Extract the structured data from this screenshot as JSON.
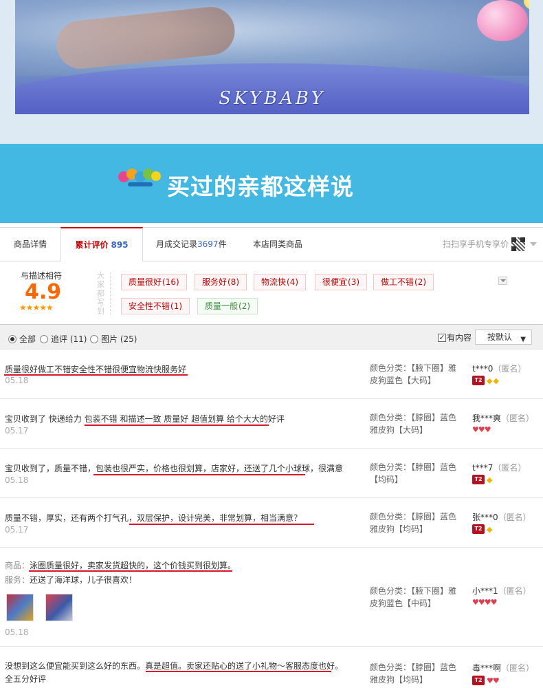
{
  "hero": {
    "brand": "SKYBABY"
  },
  "banner": {
    "title": "买过的亲都这样说",
    "logo_icon": "brand-logo-icon"
  },
  "tabs": {
    "items": [
      {
        "label": "商品详情"
      },
      {
        "label": "累计评价",
        "count": "895"
      },
      {
        "label_prefix": "月成交记录",
        "count": "3697",
        "label_suffix": "件"
      },
      {
        "label": "本店同类商品"
      }
    ],
    "scan": "扫扫享手机专享价"
  },
  "rating": {
    "label": "与描述相符",
    "score": "4.9",
    "stars": "★★★★★",
    "vertical_label": "大家都写到",
    "tags": [
      {
        "text": "质量很好",
        "num": "(16)"
      },
      {
        "text": "服务好",
        "num": "(8)"
      },
      {
        "text": "物流快",
        "num": "(4)"
      },
      {
        "text": "很便宜",
        "num": "(3)"
      },
      {
        "text": "做工不错",
        "num": "(2)"
      },
      {
        "text": "安全性不错",
        "num": "(1)"
      },
      {
        "text": "质量一般",
        "num": "(2)"
      }
    ]
  },
  "filter": {
    "options": [
      {
        "label": "全部"
      },
      {
        "label": "追评 (11)"
      },
      {
        "label": "图片 (25)"
      }
    ],
    "has_content": "有内容",
    "sort": "按默认"
  },
  "reviews": [
    {
      "text": "质量很好做工不错安全性不错很便宜物流快服务好",
      "date": "05.18",
      "sku": "颜色分类：【腋下圈】雅皮狗蓝色【大码】",
      "user": "t***0",
      "anon": "（匿名）"
    },
    {
      "text": "宝贝收到了 快递给力 包装不错 和描述一致 质量好 超值划算 给个大大的好评",
      "date": "05.17",
      "sku": "颜色分类：【脖圈】蓝色雅皮狗【大码】",
      "user": "我***爽",
      "anon": "（匿名）"
    },
    {
      "text": "宝贝收到了，质量不错，包装也很严实，价格也很划算，店家好，还送了几个小球球，很满意",
      "date": "05.18",
      "sku": "颜色分类：【脖圈】蓝色【均码】",
      "user": "t***7",
      "anon": "（匿名）"
    },
    {
      "text": "质量不错，厚实，还有两个打气孔，双层保护，设计完美，非常划算，相当满意？",
      "date": "05.17",
      "sku": "颜色分类：【脖圈】蓝色雅皮狗【均码】",
      "user": "张***0",
      "anon": "（匿名）"
    },
    {
      "label1": "商品：",
      "text": "泳圈质量很好，卖家发货超快的，这个价钱买到很划算。",
      "label2": "服务：",
      "text2": "还送了海洋球，儿子很喜欢！",
      "date": "05.18",
      "sku": "颜色分类：【腋下圈】雅皮狗蓝色【中码】",
      "user": "小***1",
      "anon": "（匿名）"
    },
    {
      "text": "没想到这么便宜能买到这么好的东西。真是超值。卖家还贴心的送了小礼物～客服态度也好。",
      "text2": "全五分好评",
      "sku": "颜色分类：【脖圈】蓝色雅皮狗【均码】",
      "user": "毒***啊",
      "anon": "（匿名）"
    }
  ],
  "colors": {
    "banner": "#43b8e3",
    "accent": "#c40000",
    "score": "#ff6600",
    "underline": "#d8192c"
  }
}
